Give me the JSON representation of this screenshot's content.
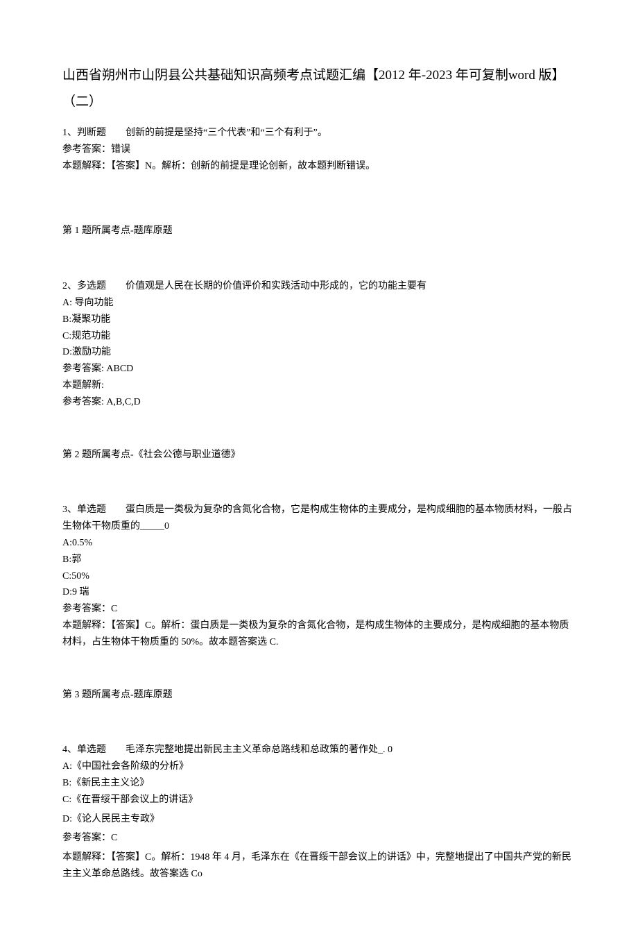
{
  "title": "山西省朔州市山阴县公共基础知识高频考点试题汇编【2012 年-2023 年可复制word 版】（二）",
  "q1": {
    "stem": "1、判断题　　创新的前提是坚持“三个代表”和“三个有利于”。",
    "ref": "参考答案：错误",
    "explain": "本题解释：【答案】N。解析：创新的前提是理论创新，故本题判断错误。",
    "source": "第 1 题所属考点-题库原题"
  },
  "q2": {
    "stem": "2、多选题　　价值观是人民在长期的价值评价和实践活动中形成的，它的功能主要有",
    "a": "A: 导向功能",
    "b": "B:凝聚功能",
    "c": "C:规范功能",
    "d": "D:激励功能",
    "ref": "参考答案: ABCD",
    "explain1": "本题解新:",
    "explain2": "参考答案: A,B,C,D",
    "source": "第 2 题所属考点-《社会公德与职业道德》"
  },
  "q3": {
    "stem": "3、单选题　　蛋白质是一类极为复杂的含氮化合物，它是构成生物体的主要成分，是构成细胞的基本物质材料，一般占生物体干物质重的_____0",
    "a": "A:0.5%",
    "b": "B:郭",
    "c": "C:50%",
    "d": "D:9 瑞",
    "ref": "参考答案：C",
    "explain": "本题解释：【答案】C。解析：蛋白质是一类极为复杂的含氮化合物，是构成生物体的主要成分，是构成细胞的基本物质材料，占生物体干物质重的 50%。故本题答案选 C.",
    "source": "第 3 题所属考点-题库原题"
  },
  "q4": {
    "stem": "4、单选题　　毛泽东完整地提出新民主主义革命总路线和总政策的著作处_. 0",
    "a": "A:《中国社会各阶级的分析》",
    "b": "B:《新民主主义论》",
    "c": "C:《在晋绥干部会议上的讲话》",
    "d": "D:《论人民民主专政》",
    "ref": "参考答案：C",
    "explain": "本题解释：【答案】C。解析：1948 年 4 月，毛泽东在《在晋绥干部会议上的讲话》中，完整地提出了中国共产党的新民主主义革命总路线。故答案选 Co"
  }
}
